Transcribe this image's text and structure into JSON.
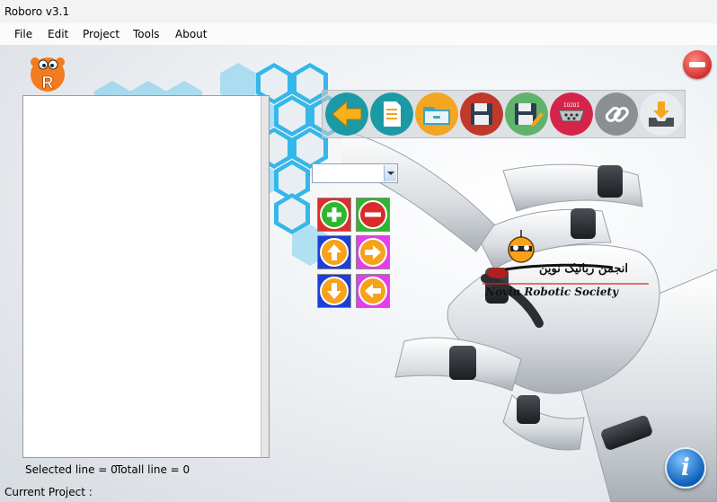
{
  "window": {
    "title": "Roboro v3.1"
  },
  "menu": {
    "items": [
      "File",
      "Edit",
      "Project",
      "Tools",
      "About"
    ]
  },
  "status": {
    "selected_line": "Selected line = 0",
    "total_line": "Totall line = 0",
    "current_project": "Current Project :"
  },
  "branding": {
    "logo_letter": "R",
    "society_name": "Novin Robotic Society",
    "society_name_fa": "انجمن رباتیک نوین"
  },
  "toolbar": {
    "icons": [
      "back-arrow-icon",
      "new-document-icon",
      "open-folder-icon",
      "save-floppy-icon",
      "save-as-icon",
      "serial-port-icon",
      "link-chain-icon",
      "download-tray-icon"
    ],
    "serial_label": "IOIOI"
  },
  "editor": {
    "combo_value": "",
    "buttons": [
      "add-icon",
      "remove-icon",
      "move-up-icon",
      "move-right-icon",
      "move-down-icon",
      "move-left-icon"
    ]
  },
  "info": {
    "label": "i"
  },
  "colors": {
    "hex_blue": "#35b7ea",
    "btn_red": "#e12b2b",
    "btn_green": "#2fb52f",
    "btn_blue": "#1d3fd6",
    "btn_magenta": "#e23fe6",
    "orange": "#f7a21b"
  }
}
